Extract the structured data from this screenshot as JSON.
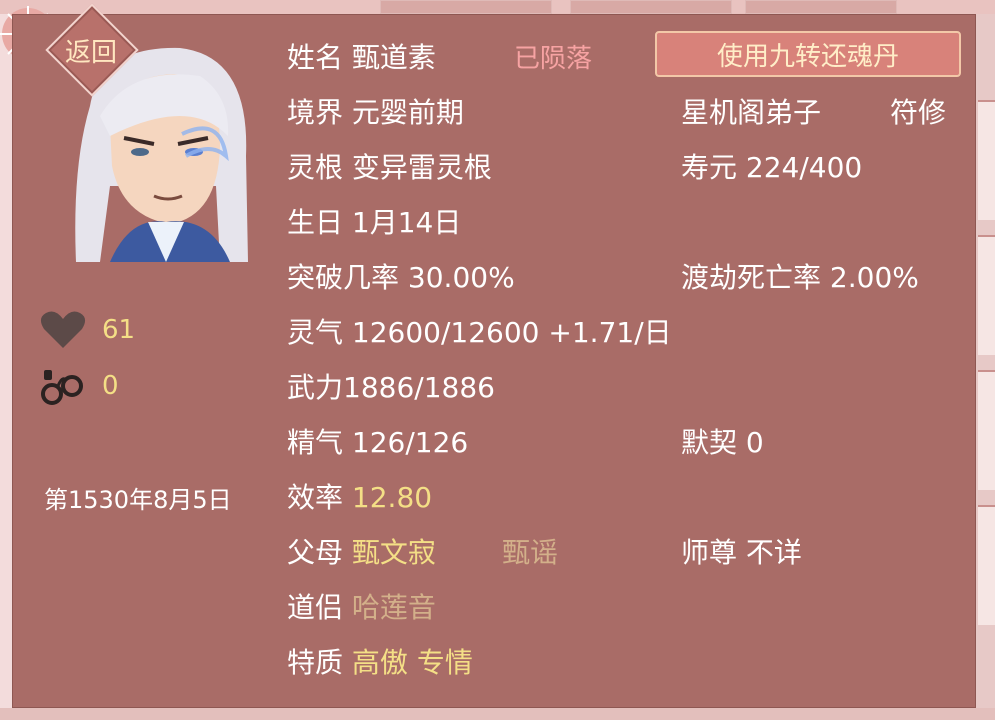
{
  "back_label": "返回",
  "revive_button_label": "使用九转还魂丹",
  "stats": {
    "love": "61",
    "shackle": "0"
  },
  "date": "第1530年8月5日",
  "character": {
    "name_label": "姓名",
    "name": "甄道素",
    "status": "已陨落",
    "realm_label": "境界",
    "realm": "元婴前期",
    "sect": "星机阁弟子",
    "profession": "符修",
    "root_label": "灵根",
    "root": "变异雷灵根",
    "lifespan_label": "寿元",
    "lifespan": "224/400",
    "birthday_label": "生日",
    "birthday": "1月14日",
    "breakthrough_label": "突破几率",
    "breakthrough": "30.00%",
    "tribulation_label": "渡劫死亡率",
    "tribulation": "2.00%",
    "qi_label": "灵气",
    "qi": "12600/12600 +1.71/日",
    "force_label": "武力",
    "force": "1886/1886",
    "essence_label": "精气",
    "essence": "126/126",
    "tacit_label": "默契",
    "tacit": "0",
    "efficiency_label": "效率",
    "efficiency": "12.80",
    "parents_label": "父母",
    "father": "甄文寂",
    "mother": "甄谣",
    "master_label": "师尊",
    "master": "不详",
    "partner_label": "道侣",
    "partner": "哈莲音",
    "traits_label": "特质",
    "trait1": "高傲",
    "trait2": "专情"
  },
  "colors": {
    "panel": "#a96c67",
    "highlight": "#f4df86",
    "deceased": "#f7a3a3",
    "muted": "#d3b08a"
  }
}
